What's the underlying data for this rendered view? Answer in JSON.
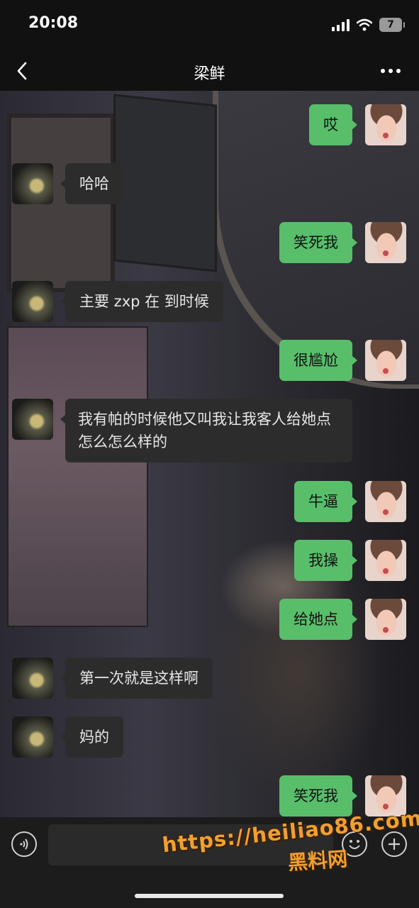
{
  "status_bar": {
    "time": "20:08",
    "battery": "7"
  },
  "nav": {
    "title": "梁鲜"
  },
  "messages": [
    {
      "from": "me",
      "text": "哎"
    },
    {
      "from": "other",
      "text": "哈哈"
    },
    {
      "from": "me",
      "text": "笑死我"
    },
    {
      "from": "other",
      "text": "主要 zxp 在 到时候"
    },
    {
      "from": "me",
      "text": "很尴尬"
    },
    {
      "from": "other",
      "text": "我有帕的时候他又叫我让我客人给她点怎么怎么样的"
    },
    {
      "from": "me",
      "text": "牛逼"
    },
    {
      "from": "me",
      "text": "我操"
    },
    {
      "from": "me",
      "text": "给她点"
    },
    {
      "from": "other",
      "text": "第一次就是这样啊"
    },
    {
      "from": "other",
      "text": "妈的"
    },
    {
      "from": "me",
      "text": "笑死我"
    }
  ],
  "watermark": {
    "url": "https://heiliao86.com",
    "name": "黑料网"
  },
  "colors": {
    "my_bubble": "#58be6a",
    "other_bubble": "#2c2c2c",
    "bar_bg": "#111111"
  },
  "icons": [
    "back-chevron-icon",
    "more-dots-icon",
    "voice-icon",
    "emoji-icon",
    "plus-icon",
    "signal-icon",
    "wifi-icon"
  ]
}
